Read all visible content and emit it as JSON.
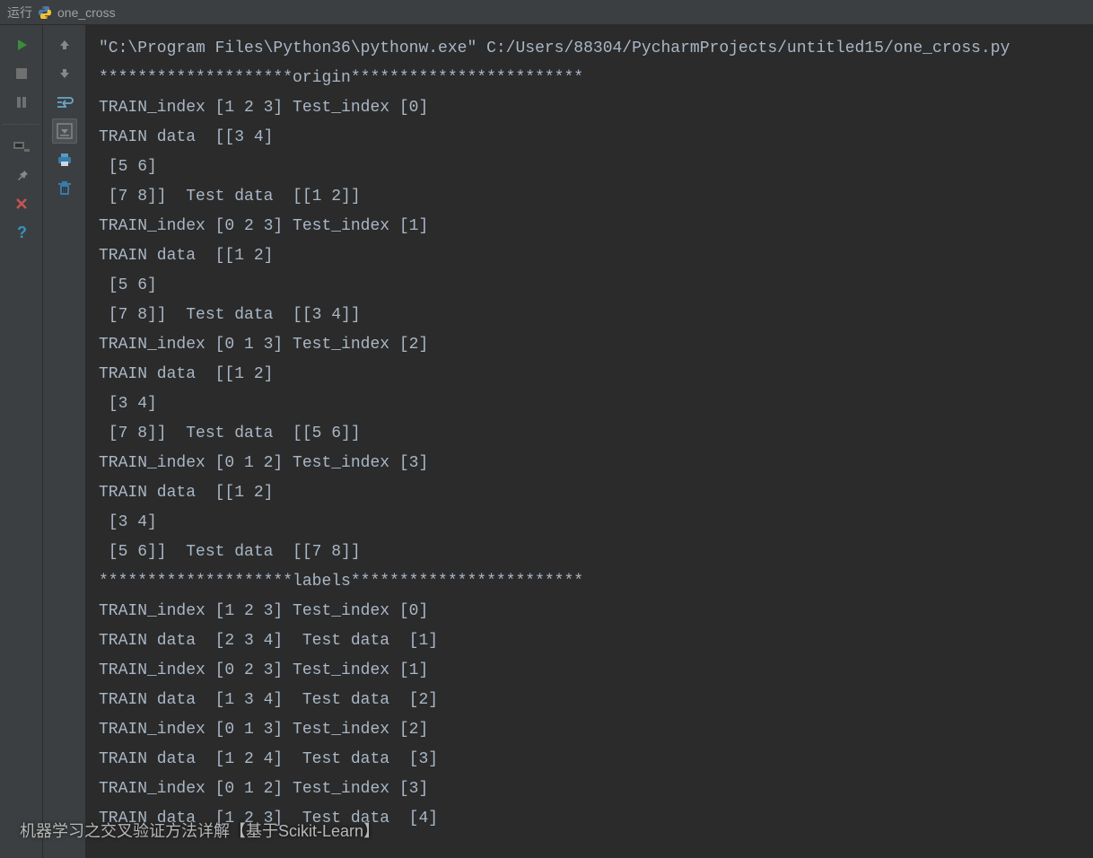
{
  "header": {
    "run_label": "运行",
    "script_name": "one_cross"
  },
  "console": {
    "lines": [
      "\"C:\\Program Files\\Python36\\pythonw.exe\" C:/Users/88304/PycharmProjects/untitled15/one_cross.py",
      "********************origin************************",
      "TRAIN_index [1 2 3] Test_index [0]",
      "TRAIN data  [[3 4]",
      " [5 6]",
      " [7 8]]  Test data  [[1 2]]",
      "TRAIN_index [0 2 3] Test_index [1]",
      "TRAIN data  [[1 2]",
      " [5 6]",
      " [7 8]]  Test data  [[3 4]]",
      "TRAIN_index [0 1 3] Test_index [2]",
      "TRAIN data  [[1 2]",
      " [3 4]",
      " [7 8]]  Test data  [[5 6]]",
      "TRAIN_index [0 1 2] Test_index [3]",
      "TRAIN data  [[1 2]",
      " [3 4]",
      " [5 6]]  Test data  [[7 8]]",
      "********************labels************************",
      "TRAIN_index [1 2 3] Test_index [0]",
      "TRAIN data  [2 3 4]  Test data  [1]",
      "TRAIN_index [0 2 3] Test_index [1]",
      "TRAIN data  [1 3 4]  Test data  [2]",
      "TRAIN_index [0 1 3] Test_index [2]",
      "TRAIN data  [1 2 4]  Test data  [3]",
      "TRAIN_index [0 1 2] Test_index [3]",
      "TRAIN data  [1 2 3]  Test data  [4]"
    ]
  },
  "watermark": "机器学习之交叉验证方法详解【基于Scikit-Learn】"
}
